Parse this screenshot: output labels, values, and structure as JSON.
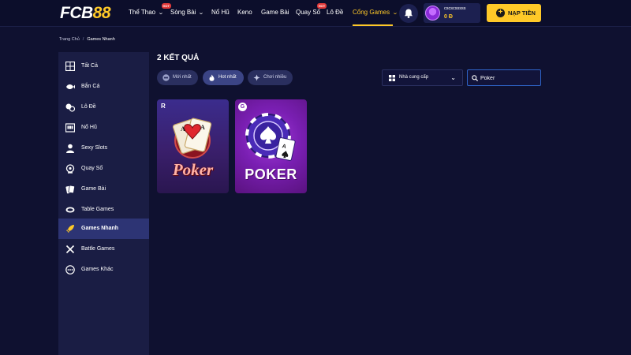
{
  "header": {
    "logo": {
      "text_a": "FCB",
      "text_b": "88"
    },
    "nav": [
      {
        "label": "Thể Thao",
        "hot": "HOT"
      },
      {
        "label": "Sòng Bài"
      },
      {
        "label": "Nổ Hũ"
      },
      {
        "label": "Keno"
      },
      {
        "label": "Game Bài"
      },
      {
        "label": "Quay Số",
        "hot": "HOT"
      },
      {
        "label": "Lô Đề"
      },
      {
        "label": "Cổng Games"
      }
    ],
    "user": {
      "name": "cscscsssss",
      "balance": "0 Đ"
    },
    "deposit_label": "NẠP TIỀN",
    "accent_color": "#ffc928"
  },
  "breadcrumb": {
    "home": "Trang Chủ",
    "current": "Games Nhanh"
  },
  "sidebar": {
    "items": [
      {
        "label": "Tất Cả",
        "icon": "grid-icon"
      },
      {
        "label": "Bắn Cá",
        "icon": "fish-icon"
      },
      {
        "label": "Lô Đề",
        "icon": "lottery-balls-icon"
      },
      {
        "label": "Nổ Hũ",
        "icon": "slot-machine-icon"
      },
      {
        "label": "Sexy Slots",
        "icon": "dealer-icon"
      },
      {
        "label": "Quay Số",
        "icon": "lottery-draw-icon"
      },
      {
        "label": "Game Bài",
        "icon": "cards-icon"
      },
      {
        "label": "Table Games",
        "icon": "table-icon"
      },
      {
        "label": "Games Nhanh",
        "icon": "rocket-icon"
      },
      {
        "label": "Battle Games",
        "icon": "swords-icon"
      },
      {
        "label": "Games Khác",
        "icon": "more-icon"
      }
    ],
    "active_index": 8
  },
  "main": {
    "results_label": "2 KẾT QUẢ",
    "sort_pills": [
      {
        "label": "Mới nhất",
        "icon": "new-icon"
      },
      {
        "label": "Hot nhất",
        "icon": "flame-icon"
      },
      {
        "label": "Chơi nhiều",
        "icon": "gamepad-icon"
      }
    ],
    "active_sort_index": 1,
    "provider_select": {
      "selected": "Nhà cung cấp"
    },
    "search": {
      "value": "Poker"
    },
    "games": [
      {
        "provider_badge": "R",
        "title": "Poker"
      },
      {
        "provider_badge": "G",
        "title": "POKER"
      }
    ]
  }
}
